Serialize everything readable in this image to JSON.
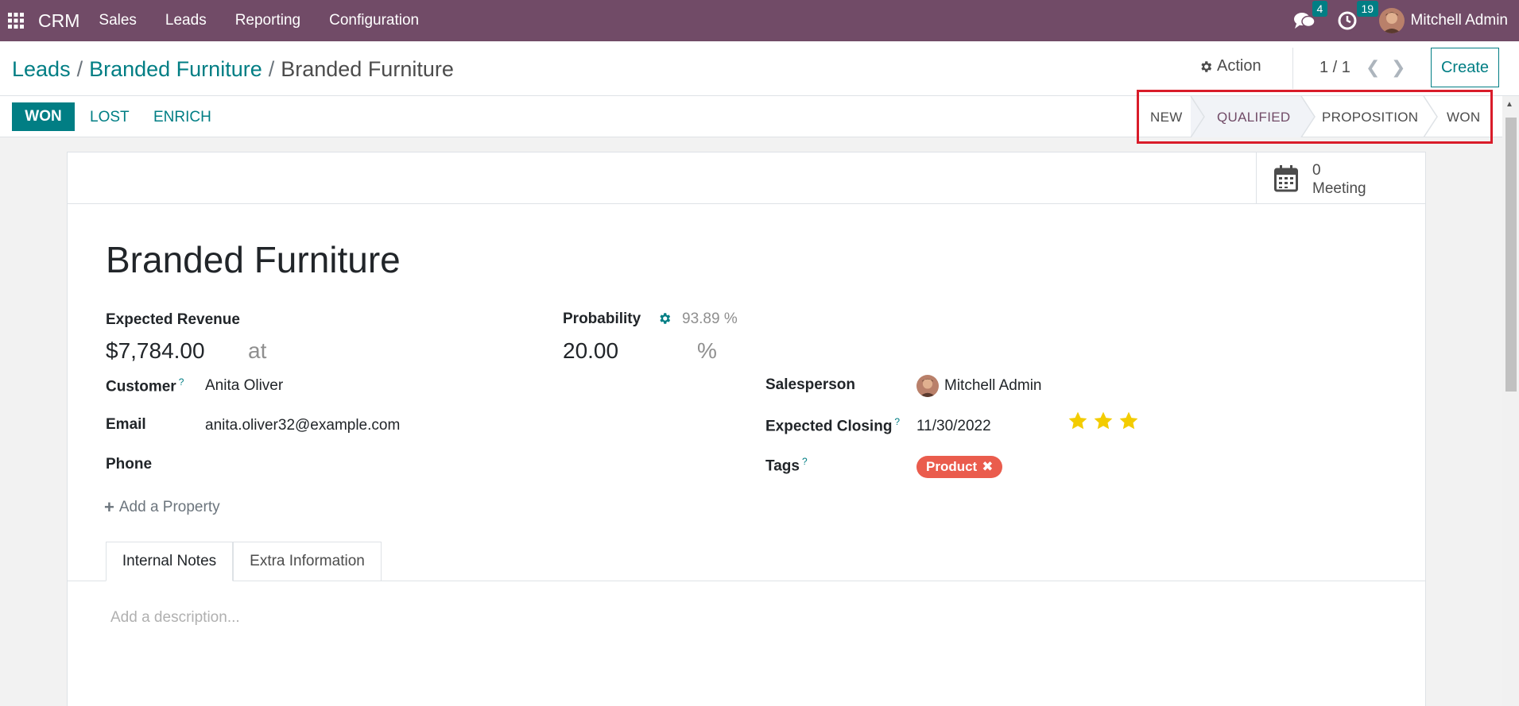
{
  "navbar": {
    "brand": "CRM",
    "menu": [
      "Sales",
      "Leads",
      "Reporting",
      "Configuration"
    ],
    "messages_count": "4",
    "activities_count": "19",
    "user_name": "Mitchell Admin"
  },
  "control_panel": {
    "breadcrumb": [
      "Leads",
      "Branded Furniture",
      "Branded Furniture"
    ],
    "action_label": "Action",
    "pager": "1 / 1",
    "create_label": "Create"
  },
  "statusbar": {
    "buttons": [
      "WON",
      "LOST",
      "ENRICH"
    ],
    "stages": [
      "NEW",
      "QUALIFIED",
      "PROPOSITION",
      "WON"
    ],
    "current_stage": "QUALIFIED"
  },
  "smart_buttons": {
    "meeting_count": "0",
    "meeting_label": "Meeting"
  },
  "record": {
    "title": "Branded Furniture",
    "expected_revenue_label": "Expected Revenue",
    "expected_revenue": "$7,784.00",
    "at_label": "at",
    "probability_label": "Probability",
    "auto_probability": "93.89 %",
    "probability": "20.00",
    "percent_sign": "%",
    "customer_label": "Customer",
    "customer": "Anita Oliver",
    "email_label": "Email",
    "email": "anita.oliver32@example.com",
    "phone_label": "Phone",
    "salesperson_label": "Salesperson",
    "salesperson": "Mitchell Admin",
    "expected_closing_label": "Expected Closing",
    "expected_closing": "11/30/2022",
    "priority_stars": 3,
    "tags_label": "Tags",
    "tags": [
      "Product"
    ],
    "help_mark": "?",
    "add_property": "Add a Property"
  },
  "notebook": {
    "tabs": [
      "Internal Notes",
      "Extra Information"
    ],
    "active_tab": "Internal Notes",
    "description_placeholder": "Add a description..."
  },
  "colors": {
    "navbar": "#714b67",
    "primary": "#017e84",
    "highlight_box": "#d91c2a",
    "tag": "#ea5c4d",
    "star": "#f3cc00"
  }
}
